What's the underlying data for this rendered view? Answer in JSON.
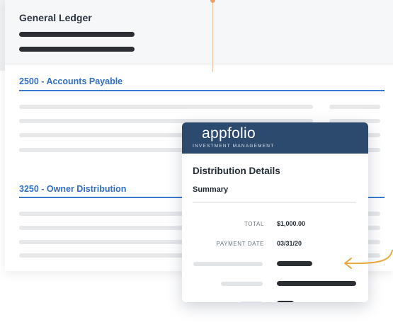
{
  "ledger": {
    "title": "General Ledger",
    "sections": [
      {
        "title": "2500 - Accounts Payable"
      },
      {
        "title": "3250 - Owner Distribution"
      }
    ]
  },
  "detail_card": {
    "brand": {
      "logo_text": "appfolio",
      "tagline": "INVESTMENT MANAGEMENT"
    },
    "title": "Distribution Details",
    "subtitle": "Summary",
    "fields": [
      {
        "label": "TOTAL",
        "value": "$1,000.00"
      },
      {
        "label": "PAYMENT DATE",
        "value": "03/31/20"
      }
    ]
  },
  "colors": {
    "accent_blue": "#3a78cc",
    "brand_navy": "#2c4a6e",
    "arrow_orange": "#e8a83a"
  },
  "icons": [
    "arrow-pointer-icon"
  ]
}
